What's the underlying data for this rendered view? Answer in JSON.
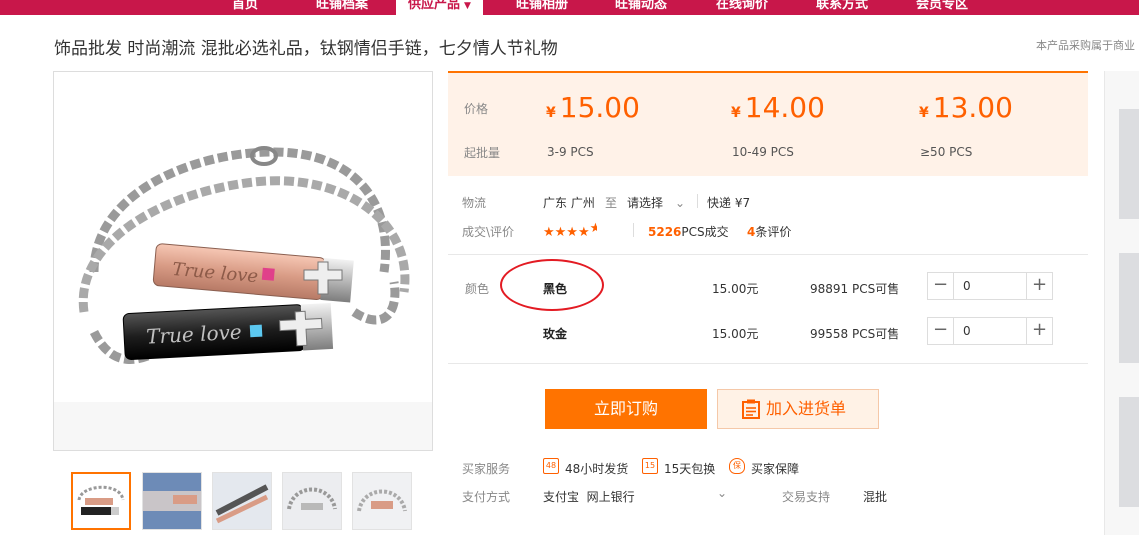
{
  "nav": {
    "items": [
      "首页",
      "旺铺档案",
      "供应产品",
      "旺铺相册",
      "旺铺动态",
      "在线询价",
      "联系方式",
      "会员专区"
    ],
    "active_index": 2
  },
  "product": {
    "title": "饰品批发 时尚潮流 混批必选礼品，钛钢情侣手链，七夕情人节礼物",
    "notice": "本产品采购属于商业"
  },
  "pricing": {
    "price_label": "价格",
    "moq_label": "起批量",
    "currency": "¥",
    "tiers": [
      {
        "price": "15.00",
        "moq": "3-9 PCS"
      },
      {
        "price": "14.00",
        "moq": "10-49 PCS"
      },
      {
        "price": "13.00",
        "moq": "≥50 PCS"
      }
    ]
  },
  "logistics": {
    "label": "物流",
    "origin": "广东 广州",
    "to": "至",
    "destination": "请选择",
    "shipping": "快递 ¥7"
  },
  "deals": {
    "label": "成交\\评价",
    "rating": 4.5,
    "count": "5226",
    "count_suffix": "PCS成交",
    "reviews": "4",
    "reviews_suffix": "条评价"
  },
  "sku": {
    "label": "颜色",
    "options": [
      {
        "name": "黑色",
        "price": "15.00元",
        "stock": "98891 PCS可售",
        "qty": "0"
      },
      {
        "name": "玫金",
        "price": "15.00元",
        "stock": "99558 PCS可售",
        "qty": "0"
      }
    ]
  },
  "actions": {
    "order": "立即订购",
    "cart": "加入进货单"
  },
  "services": {
    "label": "买家服务",
    "items": [
      {
        "icon": "48",
        "text": "48小时发货"
      },
      {
        "icon": "15",
        "text": "15天包换"
      },
      {
        "icon": "保",
        "text": "买家保障"
      }
    ]
  },
  "payment": {
    "label": "支付方式",
    "methods": "支付宝  网上银行",
    "trade_label": "交易支持",
    "trade_value": "混批"
  },
  "colors": {
    "nav": "#c8174a",
    "accent": "#ff7300",
    "price": "#ff6000"
  }
}
